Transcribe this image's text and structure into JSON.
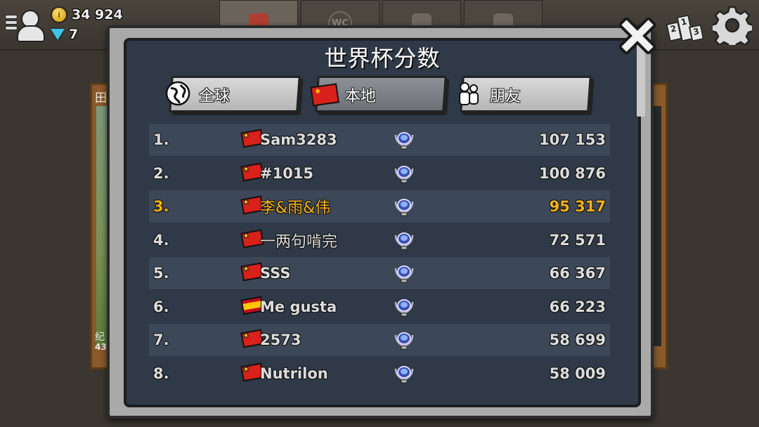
{
  "hud": {
    "coins": "34 924",
    "gems": "7"
  },
  "background": {
    "left_card_top": "田",
    "left_card_bottom": "纪",
    "left_card_num": "43"
  },
  "modal": {
    "title": "世界杯分数",
    "tabs": [
      {
        "label": "全球",
        "icon": "globe-icon"
      },
      {
        "label": "本地",
        "icon": "china-flag-icon",
        "active": true
      },
      {
        "label": "朋友",
        "icon": "friends-icon"
      }
    ]
  },
  "leaderboard": [
    {
      "rank": "1.",
      "flag": "cn",
      "name": "Sam3283",
      "score": "107 153"
    },
    {
      "rank": "2.",
      "flag": "cn",
      "name": "#1015",
      "score": "100 876"
    },
    {
      "rank": "3.",
      "flag": "cn",
      "name": "李&雨&伟",
      "score": "95 317",
      "highlight": true
    },
    {
      "rank": "4.",
      "flag": "cn",
      "name": "一两句啃完",
      "score": "72 571"
    },
    {
      "rank": "5.",
      "flag": "cn",
      "name": "SSS",
      "score": "66 367"
    },
    {
      "rank": "6.",
      "flag": "es",
      "name": "Me gusta",
      "score": "66 223"
    },
    {
      "rank": "7.",
      "flag": "cn",
      "name": "2573",
      "score": "58 699"
    },
    {
      "rank": "8.",
      "flag": "cn",
      "name": "Nutrilon",
      "score": "58 009"
    }
  ],
  "colors": {
    "highlight": "#f5b21a",
    "panel": "#2f3947",
    "row_alt": "#3c4757"
  }
}
